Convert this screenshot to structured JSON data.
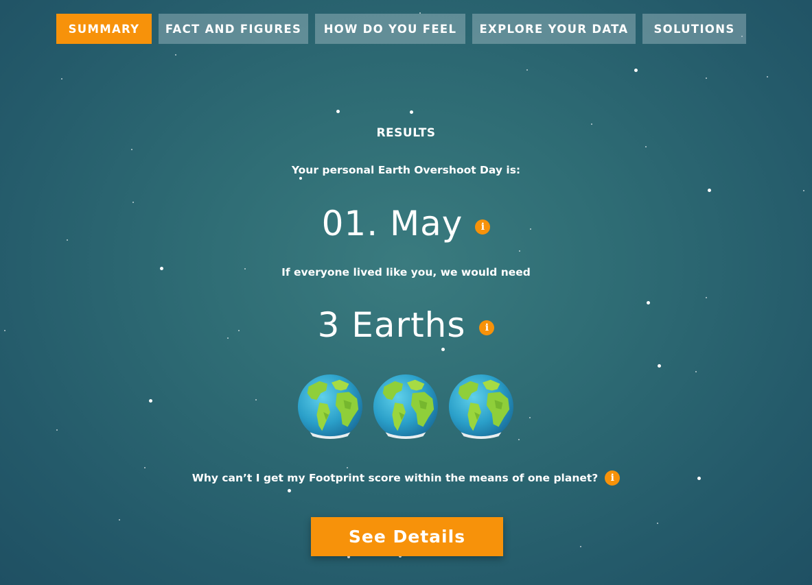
{
  "nav": {
    "tabs": [
      {
        "label": "SUMMARY",
        "active": true
      },
      {
        "label": "FACT AND FIGURES",
        "active": false
      },
      {
        "label": "HOW DO YOU FEEL",
        "active": false
      },
      {
        "label": "EXPLORE YOUR DATA",
        "active": false
      },
      {
        "label": "SOLUTIONS",
        "active": false
      }
    ]
  },
  "results": {
    "title": "RESULTS",
    "overshoot_label": "Your personal Earth Overshoot Day is:",
    "overshoot_date": "01. May",
    "need_label": "If everyone lived like you, we would need",
    "earths_value": "3 Earths",
    "earths_count": 3,
    "why_question": "Why can’t I get my Footprint score within the means of one planet?",
    "info_glyph": "i",
    "details_button": "See Details"
  },
  "theme": {
    "accent": "#f7920a",
    "background": "#2f6d75",
    "tab_inactive": "#7fa1a8"
  }
}
